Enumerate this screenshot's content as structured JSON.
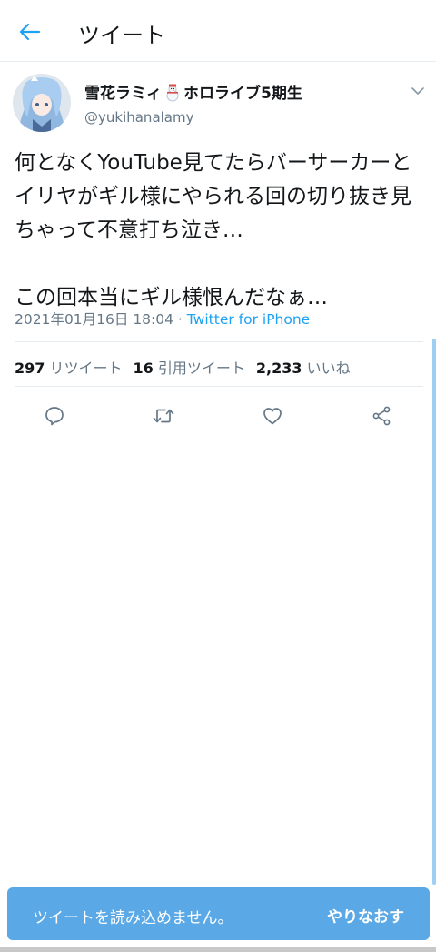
{
  "header": {
    "title": "ツイート",
    "back_icon": "arrow-left-icon"
  },
  "tweet": {
    "author_name_part1": "雪花ラミィ",
    "author_name_part2": "ホロライブ5期生",
    "author_emoji": "snowman-emoji",
    "handle": "@yukihanalamy",
    "text": "何となくYouTube見てたらバーサーカーとイリヤがギル様にやられる回の切り抜き見ちゃって不意打ち泣き…\n\nこの回本当にギル様恨んだなぁ…",
    "timestamp": "2021年01月16日 18:04",
    "separator": " · ",
    "source": "Twitter for iPhone"
  },
  "stats": {
    "retweets_count": "297",
    "retweets_label": "リツイート",
    "quotes_count": "16",
    "quotes_label": "引用ツイート",
    "likes_count": "2,233",
    "likes_label": "いいね"
  },
  "actions": [
    "reply-icon",
    "retweet-icon",
    "like-icon",
    "share-icon"
  ],
  "toast": {
    "message": "ツイートを読み込めません。",
    "retry_label": "やりなおす"
  },
  "colors": {
    "accent": "#1da1f2",
    "toast_bg": "#5aa9e6",
    "muted": "#657786",
    "text": "#14171a"
  }
}
